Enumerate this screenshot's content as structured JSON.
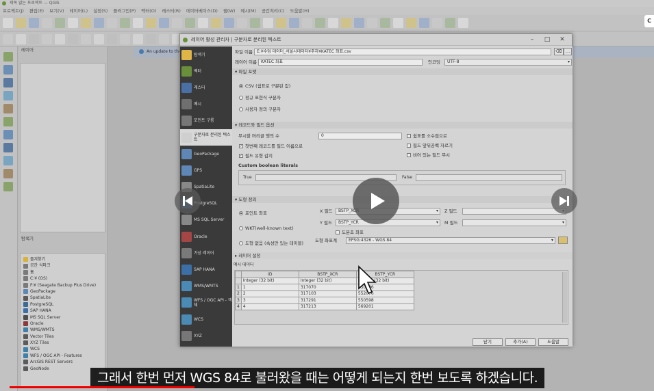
{
  "app": {
    "window_title": "제목 없는 프로젝트 — QGIS"
  },
  "menu": [
    "프로젝트(J)",
    "편집(E)",
    "보기(V)",
    "레이어(L)",
    "설정(S)",
    "플러그인(P)",
    "벡터(O)",
    "래스터(R)",
    "데이터베이스(D)",
    "웹(W)",
    "메시(M)",
    "공간처리(C)",
    "도움말(H)"
  ],
  "layers_panel": {
    "title": "레이어"
  },
  "browser_panel": {
    "title": "탐색기",
    "items": [
      {
        "icon": "star-icon",
        "label": "즐겨찾기",
        "color": "#d8b23a"
      },
      {
        "icon": "bookmark-icon",
        "label": "공간 식마크",
        "color": "#7a7a7a"
      },
      {
        "icon": "home-icon",
        "label": "홈",
        "color": "#7a7a7a"
      },
      {
        "icon": "drive-icon",
        "label": "C:¥ (OS)",
        "color": "#7a7a7a"
      },
      {
        "icon": "drive-icon",
        "label": "F:¥ (Seagate Backup Plus Drive)",
        "color": "#7a7a7a"
      },
      {
        "icon": "geopackage-icon",
        "label": "GeoPackage",
        "color": "#5f87b5"
      },
      {
        "icon": "spatialite-icon",
        "label": "SpatiaLite",
        "color": "#5a5a5a"
      },
      {
        "icon": "postgresql-icon",
        "label": "PostgreSQL",
        "color": "#3d6a94"
      },
      {
        "icon": "saphana-icon",
        "label": "SAP HANA",
        "color": "#3b6fa6"
      },
      {
        "icon": "mssql-icon",
        "label": "MS SQL Server",
        "color": "#4e4e4e"
      },
      {
        "icon": "oracle-icon",
        "label": "Oracle",
        "color": "#8a3c3c"
      },
      {
        "icon": "wms-icon",
        "label": "WMS/WMTS",
        "color": "#3f7fa8"
      },
      {
        "icon": "vectortiles-icon",
        "label": "Vector Tiles",
        "color": "#5b5b5b"
      },
      {
        "icon": "xyz-icon",
        "label": "XYZ Tiles",
        "color": "#5b5b5b"
      },
      {
        "icon": "wcs-icon",
        "label": "WCS",
        "color": "#3f7fa8"
      },
      {
        "icon": "wfs-icon",
        "label": "WFS / OGC API - Features",
        "color": "#3f7fa8"
      },
      {
        "icon": "arcgis-icon",
        "label": "ArcGIS REST Servers",
        "color": "#5b5b5b"
      },
      {
        "icon": "geonode-icon",
        "label": "GeoNode",
        "color": "#5b5b5b"
      }
    ]
  },
  "message_bar": {
    "text": "An update to the Q"
  },
  "dialog": {
    "title": "레이어 활성 관리자 | 구분자로 분리된 텍스트",
    "sidebar": [
      {
        "label": "탐색기",
        "icon": "folder-icon",
        "color": "#e0b548"
      },
      {
        "label": "벡터",
        "icon": "vector-icon",
        "color": "#6a8f3a"
      },
      {
        "label": "래스터",
        "icon": "raster-icon",
        "color": "#4a6fa5"
      },
      {
        "label": "메시",
        "icon": "mesh-icon",
        "color": "#6f6f6f"
      },
      {
        "label": "포인트 구름",
        "icon": "pointcloud-icon",
        "color": "#777777"
      },
      {
        "label": "구분자로 분리된 텍스트",
        "icon": "delimited-text-icon",
        "color": "#cfcfcf",
        "active": true
      },
      {
        "label": "GeoPackage",
        "icon": "geopackage-icon",
        "color": "#5f87b5"
      },
      {
        "label": "GPS",
        "icon": "gps-icon",
        "color": "#5f87b5"
      },
      {
        "label": "SpatiaLite",
        "icon": "spatialite-icon",
        "color": "#888888"
      },
      {
        "label": "PostgreSQL",
        "icon": "postgresql-icon",
        "color": "#3d6a94"
      },
      {
        "label": "MS SQL Server",
        "icon": "mssql-icon",
        "color": "#888888"
      },
      {
        "label": "Oracle",
        "icon": "oracle-icon",
        "color": "#a54646"
      },
      {
        "label": "가상 레이어",
        "icon": "virtual-layer-icon",
        "color": "#7a7a7a"
      },
      {
        "label": "SAP HANA",
        "icon": "saphana-icon",
        "color": "#3b6fa6"
      },
      {
        "label": "WMS/WMTS",
        "icon": "wms-icon",
        "color": "#4a8ab5"
      },
      {
        "label": "WFS / OGC API - 객체",
        "icon": "wfs-icon",
        "color": "#4a8ab5"
      },
      {
        "label": "WCS",
        "icon": "wcs-icon",
        "color": "#4a8ab5"
      },
      {
        "label": "XYZ",
        "icon": "xyz-icon",
        "color": "#777777"
      },
      {
        "label": "벡터 타일",
        "icon": "vector-tile-icon",
        "color": "#777777"
      },
      {
        "label": "ArcGIS REST Server",
        "icon": "arcgis-icon",
        "color": "#777777"
      },
      {
        "label": "GeoNode",
        "icon": "geonode-icon",
        "color": "#777777"
      }
    ],
    "file_name_label": "파일 이름",
    "file_name_value": "E:¥수업 데이터_서울시데이터¥주차¥KATEC 좌표.csv",
    "layer_name_label": "레이어 이름",
    "layer_name_value": "KATEC 좌표",
    "encoding_label": "인코딩",
    "encoding_value": "UTF-8",
    "file_format_section": "파일 포맷",
    "format_options": [
      {
        "label": "CSV (쉼표로 구분된 값)",
        "selected": true
      },
      {
        "label": "정규 표현식 구분자",
        "selected": false
      },
      {
        "label": "사용자 정의 구분자",
        "selected": false
      }
    ],
    "record_section": "레코드와 필드 옵션",
    "skip_lines_label": "무시할 머리글 행의 수",
    "skip_lines_value": "0",
    "record_left_checks": [
      {
        "label": "첫번째 레코드를 필드 이름으로",
        "checked": true
      },
      {
        "label": "필드 유형 감지",
        "checked": true
      }
    ],
    "record_right_checks": [
      {
        "label": "쉼표를 소수점으로",
        "checked": false
      },
      {
        "label": "필드 앞뒤공백 자르기",
        "checked": false
      },
      {
        "label": "비어 있는 필드 무시",
        "checked": false
      }
    ],
    "boolean_label": "Custom boolean literals",
    "true_label": "True",
    "false_label": "False",
    "geometry_section": "도형 정의",
    "geometry_options": [
      {
        "label": "포인트 좌표",
        "selected": true
      },
      {
        "label": "WKT(well-known text)",
        "selected": false
      },
      {
        "label": "도형 없음 (속성만 있는 테이블)",
        "selected": false
      }
    ],
    "x_field_label": "X 필드",
    "x_field_value": "BSTP_XCR",
    "y_field_label": "Y 필드",
    "y_field_value": "BSTP_YCR",
    "z_field_label": "Z 필드",
    "m_field_label": "M 필드",
    "dms_label": "도분초 좌표",
    "crs_label": "도형 좌표계",
    "crs_value": "EPSG:4326 - WGS 84",
    "layer_settings_section": "레이어 설정",
    "sample_section": "예시 데이터",
    "table": {
      "columns": [
        "ID",
        "BSTP_XCR",
        "BSTP_YCR"
      ],
      "type_row": [
        "Integer (32 bit)",
        "Integer (32 bit)",
        "Integer (32 bit)"
      ],
      "rows": [
        [
          "1",
          "1",
          "317070",
          "550406"
        ],
        [
          "2",
          "2",
          "317103",
          "552076"
        ],
        [
          "3",
          "3",
          "317291",
          "550598"
        ],
        [
          "4",
          "4",
          "317213",
          "569201"
        ]
      ]
    },
    "buttons": {
      "close": "닫기",
      "add": "추가(A)",
      "help": "도움말"
    }
  },
  "video": {
    "subtitle": "그래서 한번 먼저 WGS 84로 불러왔을 때는 어떻게 되는지 한번 보도록 하겠습니다.",
    "badge": "C"
  }
}
